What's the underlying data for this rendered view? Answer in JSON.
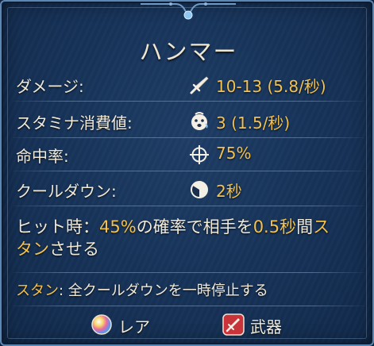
{
  "item": {
    "name": "ハンマー",
    "stats": [
      {
        "label": "ダメージ:",
        "icon": "sword-icon",
        "value": "10-13 (5.8/秒)"
      },
      {
        "label": "スタミナ消費値:",
        "icon": "stamina-face-icon",
        "value": "3 (1.5/秒)"
      },
      {
        "label": "命中率:",
        "icon": "crosshair-icon",
        "value": "75%"
      },
      {
        "label": "クールダウン:",
        "icon": "cooldown-icon",
        "value": "2秒"
      }
    ],
    "effect": {
      "prefix": "ヒット時：",
      "chance": "45%",
      "mid1": "の確率で相手を",
      "duration": "0.5秒",
      "mid2": "間",
      "status_a": "ス",
      "status_b": "タン",
      "suffix": "させる"
    },
    "note": {
      "keyword": "スタン",
      "text": ": 全クールダウンを一時停止する"
    },
    "rarity": {
      "label": "レア",
      "icon": "rainbow-orb-icon"
    },
    "category": {
      "label": "武器",
      "icon": "weapon-badge-icon"
    }
  },
  "colors": {
    "highlight": "#f2c14e",
    "text": "#f2ead8",
    "panel": "#17345a",
    "border": "#5d87b3"
  }
}
